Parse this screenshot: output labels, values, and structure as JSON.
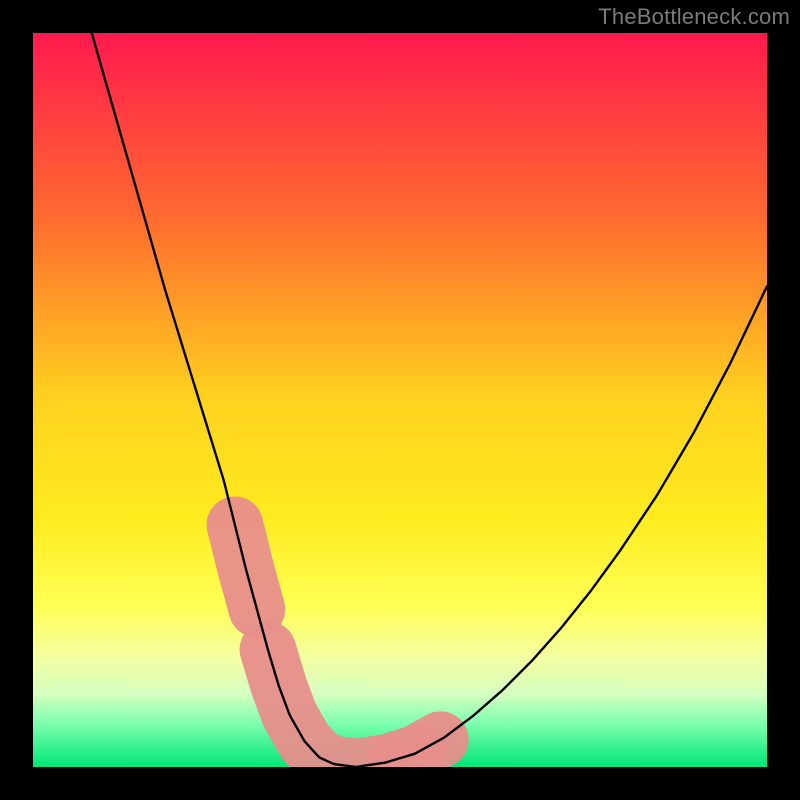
{
  "watermark": "TheBottleneck.com",
  "chart_data": {
    "type": "line",
    "title": "",
    "xlabel": "",
    "ylabel": "",
    "xlim": [
      0,
      100
    ],
    "ylim": [
      0,
      100
    ],
    "grid": false,
    "legend": false,
    "background_gradient": {
      "stops": [
        {
          "offset": 0.0,
          "color": "#ff1a4e"
        },
        {
          "offset": 0.25,
          "color": "#ff6a2f"
        },
        {
          "offset": 0.5,
          "color": "#ffd21f"
        },
        {
          "offset": 0.66,
          "color": "#ffeb1f"
        },
        {
          "offset": 0.78,
          "color": "#ffff55"
        },
        {
          "offset": 0.85,
          "color": "#f4ffa0"
        },
        {
          "offset": 0.9,
          "color": "#d6ffc0"
        },
        {
          "offset": 0.94,
          "color": "#7fffb0"
        },
        {
          "offset": 1.0,
          "color": "#00e676"
        }
      ]
    },
    "series": [
      {
        "name": "bottleneck-curve",
        "x": [
          8,
          10,
          12,
          14,
          16,
          18,
          20,
          22,
          24,
          26,
          27.5,
          29,
          30.5,
          32,
          33.5,
          35,
          37,
          39,
          41,
          44,
          48,
          52,
          56,
          60,
          64,
          68,
          72,
          76,
          80,
          85,
          90,
          95,
          100
        ],
        "y": [
          100,
          93,
          86,
          79,
          72,
          65,
          58.5,
          52,
          45.5,
          39,
          33,
          27,
          21.5,
          16,
          11,
          7,
          3.5,
          1.3,
          0.4,
          0.0,
          0.6,
          1.8,
          4.0,
          7.0,
          10.5,
          14.5,
          19.0,
          24.0,
          29.5,
          37.0,
          45.5,
          55.0,
          65.5
        ]
      }
    ],
    "highlight_band": {
      "name": "bottom-tolerance-band",
      "y_range": [
        0,
        3
      ],
      "color": "#e78e8b",
      "segments": [
        {
          "x_start": 27.5,
          "x_end": 30.5
        },
        {
          "x_start": 32.0,
          "x_end": 48.0
        },
        {
          "x_start": 49.5,
          "x_end": 52.5
        },
        {
          "x_start": 53.5,
          "x_end": 55.5
        }
      ],
      "curve_trace": true
    }
  }
}
